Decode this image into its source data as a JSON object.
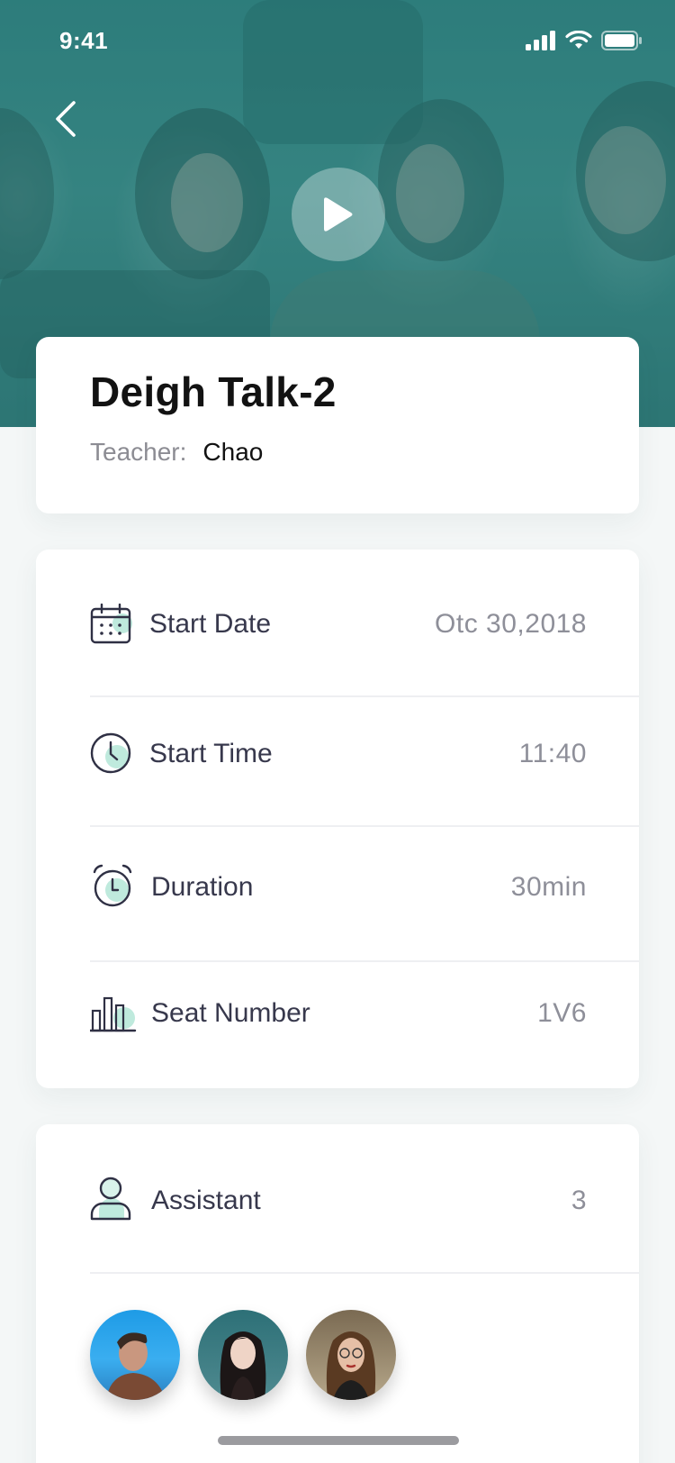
{
  "status_bar": {
    "time": "9:41"
  },
  "hero": {
    "back_icon": "chevron-left-icon",
    "play_icon": "play-icon"
  },
  "course": {
    "title": "Deigh Talk-2",
    "teacher_label": "Teacher:",
    "teacher_name": "Chao"
  },
  "details": [
    {
      "icon": "calendar-icon",
      "label": "Start Date",
      "value": "Otc 30,2018"
    },
    {
      "icon": "clock-icon",
      "label": "Start Time",
      "value": "11:40"
    },
    {
      "icon": "alarm-clock-icon",
      "label": "Duration",
      "value": "30min"
    },
    {
      "icon": "bar-chart-icon",
      "label": "Seat Number",
      "value": "1V6"
    }
  ],
  "assistant": {
    "icon": "person-icon",
    "label": "Assistant",
    "count": "3",
    "avatars": [
      "avatar-1",
      "avatar-2",
      "avatar-3"
    ]
  },
  "colors": {
    "accent": "#bfeadd",
    "hero_tint": "#2f7b7c",
    "label": "#37384c",
    "value": "#8e8f99",
    "background": "#f4f7f7"
  }
}
